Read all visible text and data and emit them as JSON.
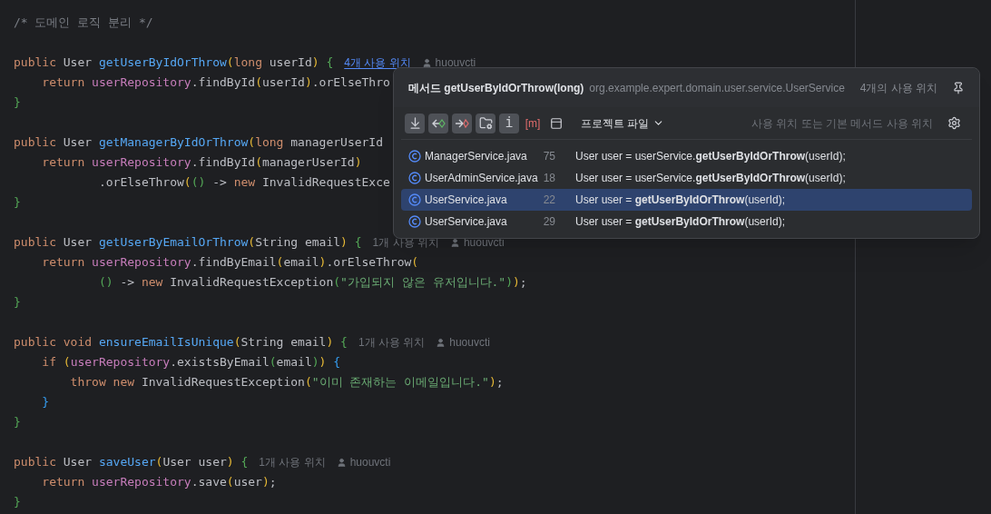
{
  "editor": {
    "blocks": [
      {
        "lines": [
          {
            "tokens": [
              {
                "kind": "comment",
                "text": "/* 도메인 로직 분리 */"
              }
            ]
          }
        ]
      },
      {
        "lines": [
          {
            "tokens": [
              {
                "kind": "kw",
                "text": "public "
              },
              {
                "kind": "plain",
                "text": "User "
              },
              {
                "kind": "fn",
                "text": "getUserByIdOrThrow"
              },
              {
                "kind": "y",
                "text": "("
              },
              {
                "kind": "kw",
                "text": "long "
              },
              {
                "kind": "plain",
                "text": "userId"
              },
              {
                "kind": "y",
                "text": ") "
              },
              {
                "kind": "g",
                "text": "{"
              }
            ],
            "hint": {
              "usages": "4개 사용 위치",
              "author": "huouvcti",
              "active": true
            }
          },
          {
            "tokens": [
              {
                "kind": "kw",
                "text": "    return "
              },
              {
                "kind": "field",
                "text": "userRepository"
              },
              {
                "kind": "plain",
                "text": ".findById"
              },
              {
                "kind": "y",
                "text": "("
              },
              {
                "kind": "plain",
                "text": "userId"
              },
              {
                "kind": "y",
                "text": ")"
              },
              {
                "kind": "plain",
                "text": ".orElseThro"
              }
            ]
          },
          {
            "tokens": [
              {
                "kind": "g",
                "text": "}"
              }
            ]
          }
        ]
      },
      {
        "lines": [
          {
            "tokens": [
              {
                "kind": "kw",
                "text": "public "
              },
              {
                "kind": "plain",
                "text": "User "
              },
              {
                "kind": "fn",
                "text": "getManagerByIdOrThrow"
              },
              {
                "kind": "y",
                "text": "("
              },
              {
                "kind": "kw",
                "text": "long "
              },
              {
                "kind": "plain",
                "text": "managerUserId"
              }
            ]
          },
          {
            "tokens": [
              {
                "kind": "kw",
                "text": "    return "
              },
              {
                "kind": "field",
                "text": "userRepository"
              },
              {
                "kind": "plain",
                "text": ".findById"
              },
              {
                "kind": "y",
                "text": "("
              },
              {
                "kind": "plain",
                "text": "managerUserId"
              },
              {
                "kind": "y",
                "text": ")"
              }
            ]
          },
          {
            "tokens": [
              {
                "kind": "plain",
                "text": "            .orElseThrow"
              },
              {
                "kind": "y",
                "text": "("
              },
              {
                "kind": "g",
                "text": "()"
              },
              {
                "kind": "plain",
                "text": " -> "
              },
              {
                "kind": "kw",
                "text": "new "
              },
              {
                "kind": "plain",
                "text": "InvalidRequestExce"
              }
            ]
          },
          {
            "tokens": [
              {
                "kind": "g",
                "text": "}"
              }
            ]
          }
        ]
      },
      {
        "lines": [
          {
            "tokens": [
              {
                "kind": "kw",
                "text": "public "
              },
              {
                "kind": "plain",
                "text": "User "
              },
              {
                "kind": "fn",
                "text": "getUserByEmailOrThrow"
              },
              {
                "kind": "y",
                "text": "("
              },
              {
                "kind": "plain",
                "text": "String email"
              },
              {
                "kind": "y",
                "text": ") "
              },
              {
                "kind": "g",
                "text": "{"
              }
            ],
            "hint": {
              "usages": "1개 사용 위치",
              "author": "huouvcti",
              "active": false
            }
          },
          {
            "tokens": [
              {
                "kind": "kw",
                "text": "    return "
              },
              {
                "kind": "field",
                "text": "userRepository"
              },
              {
                "kind": "plain",
                "text": ".findByEmail"
              },
              {
                "kind": "y",
                "text": "("
              },
              {
                "kind": "plain",
                "text": "email"
              },
              {
                "kind": "y",
                "text": ")"
              },
              {
                "kind": "plain",
                "text": ".orElseThrow"
              },
              {
                "kind": "y",
                "text": "("
              }
            ]
          },
          {
            "tokens": [
              {
                "kind": "g",
                "text": "            ()"
              },
              {
                "kind": "plain",
                "text": " -> "
              },
              {
                "kind": "kw",
                "text": "new "
              },
              {
                "kind": "plain",
                "text": "InvalidRequestException"
              },
              {
                "kind": "g",
                "text": "("
              },
              {
                "kind": "str",
                "text": "\"가입되지 않은 유저입니다.\""
              },
              {
                "kind": "g",
                "text": ")"
              },
              {
                "kind": "y",
                "text": ")"
              },
              {
                "kind": "plain",
                "text": ";"
              }
            ]
          },
          {
            "tokens": [
              {
                "kind": "g",
                "text": "}"
              }
            ]
          }
        ]
      },
      {
        "lines": [
          {
            "tokens": [
              {
                "kind": "kw",
                "text": "public void "
              },
              {
                "kind": "fn",
                "text": "ensureEmailIsUnique"
              },
              {
                "kind": "y",
                "text": "("
              },
              {
                "kind": "plain",
                "text": "String email"
              },
              {
                "kind": "y",
                "text": ") "
              },
              {
                "kind": "g",
                "text": "{"
              }
            ],
            "hint": {
              "usages": "1개 사용 위치",
              "author": "huouvcti",
              "active": false
            }
          },
          {
            "tokens": [
              {
                "kind": "kw",
                "text": "    if "
              },
              {
                "kind": "y",
                "text": "("
              },
              {
                "kind": "field",
                "text": "userRepository"
              },
              {
                "kind": "plain",
                "text": ".existsByEmail"
              },
              {
                "kind": "g",
                "text": "("
              },
              {
                "kind": "plain",
                "text": "email"
              },
              {
                "kind": "g",
                "text": ")"
              },
              {
                "kind": "y",
                "text": ") "
              },
              {
                "kind": "b",
                "text": "{"
              }
            ]
          },
          {
            "tokens": [
              {
                "kind": "kw",
                "text": "        throw new "
              },
              {
                "kind": "plain",
                "text": "InvalidRequestException"
              },
              {
                "kind": "y",
                "text": "("
              },
              {
                "kind": "str",
                "text": "\"이미 존재하는 이메일입니다.\""
              },
              {
                "kind": "y",
                "text": ")"
              },
              {
                "kind": "plain",
                "text": ";"
              }
            ]
          },
          {
            "tokens": [
              {
                "kind": "b",
                "text": "    }"
              }
            ]
          },
          {
            "tokens": [
              {
                "kind": "g",
                "text": "}"
              }
            ]
          }
        ]
      },
      {
        "lines": [
          {
            "tokens": [
              {
                "kind": "kw",
                "text": "public "
              },
              {
                "kind": "plain",
                "text": "User "
              },
              {
                "kind": "fn",
                "text": "saveUser"
              },
              {
                "kind": "y",
                "text": "("
              },
              {
                "kind": "plain",
                "text": "User user"
              },
              {
                "kind": "y",
                "text": ") "
              },
              {
                "kind": "g",
                "text": "{"
              }
            ],
            "hint": {
              "usages": "1개 사용 위치",
              "author": "huouvcti",
              "active": false
            }
          },
          {
            "tokens": [
              {
                "kind": "kw",
                "text": "    return "
              },
              {
                "kind": "field",
                "text": "userRepository"
              },
              {
                "kind": "plain",
                "text": ".save"
              },
              {
                "kind": "y",
                "text": "("
              },
              {
                "kind": "plain",
                "text": "user"
              },
              {
                "kind": "y",
                "text": ")"
              },
              {
                "kind": "plain",
                "text": ";"
              }
            ]
          },
          {
            "tokens": [
              {
                "kind": "g",
                "text": "}"
              }
            ]
          }
        ]
      }
    ]
  },
  "popup": {
    "kind_label": "메서드",
    "method": "getUserByIdOrThrow(long)",
    "class_path": "org.example.expert.domain.user.service.UserService",
    "count": "4개의 사용 위치",
    "toolbar": [
      {
        "on": true
      },
      {
        "on": true
      },
      {
        "on": true
      },
      {
        "on": true
      },
      {
        "on": true,
        "label": "i"
      },
      {
        "on": false,
        "label": "[m]"
      },
      {
        "on": false
      }
    ],
    "scope": "프로젝트 파일",
    "filter_hint": "사용 위치 또는 기본 메서드 사용 위치",
    "rows": [
      {
        "file": "ManagerService.java",
        "line": "75",
        "code": "User user = userService.**getUserByIdOrThrow**(userId);",
        "selected": false
      },
      {
        "file": "UserAdminService.java",
        "line": "18",
        "code": "User user = userService.**getUserByIdOrThrow**(userId);",
        "selected": false
      },
      {
        "file": "UserService.java",
        "line": "22",
        "code": "User user = **getUserByIdOrThrow**(userId);",
        "selected": true
      },
      {
        "file": "UserService.java",
        "line": "29",
        "code": "User user = **getUserByIdOrThrow**(userId);",
        "selected": false
      }
    ]
  }
}
